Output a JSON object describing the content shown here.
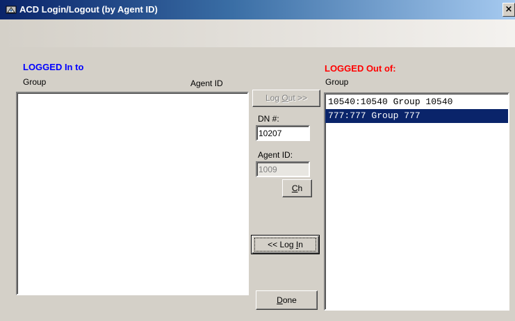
{
  "window": {
    "title": "ACD Login/Logout (by Agent ID)",
    "close_glyph": "×"
  },
  "logged_in": {
    "title": "LOGGED  In to",
    "col_group": "Group",
    "col_agent": "Agent ID",
    "items": []
  },
  "logged_out": {
    "title": "LOGGED Out of:",
    "col_group": "Group",
    "items": [
      "10540:10540 Group 10540",
      "777:777 Group 777"
    ],
    "selected_index": 1
  },
  "controls": {
    "logout_btn": {
      "pre": "Log ",
      "ul": "O",
      "post": "ut >>"
    },
    "dn_label": "DN #:",
    "dn_value": "10207",
    "agent_label": "Agent ID:",
    "agent_value": "1009",
    "ch_btn": {
      "ul": "C",
      "post": "h"
    },
    "login_btn": {
      "pre": "<< Log ",
      "ul": "I",
      "post": "n"
    },
    "done_btn": {
      "ul": "D",
      "post": "one"
    }
  },
  "colors": {
    "in_title": "#0000ff",
    "out_title": "#ff0000",
    "selection": "#0a246a"
  }
}
